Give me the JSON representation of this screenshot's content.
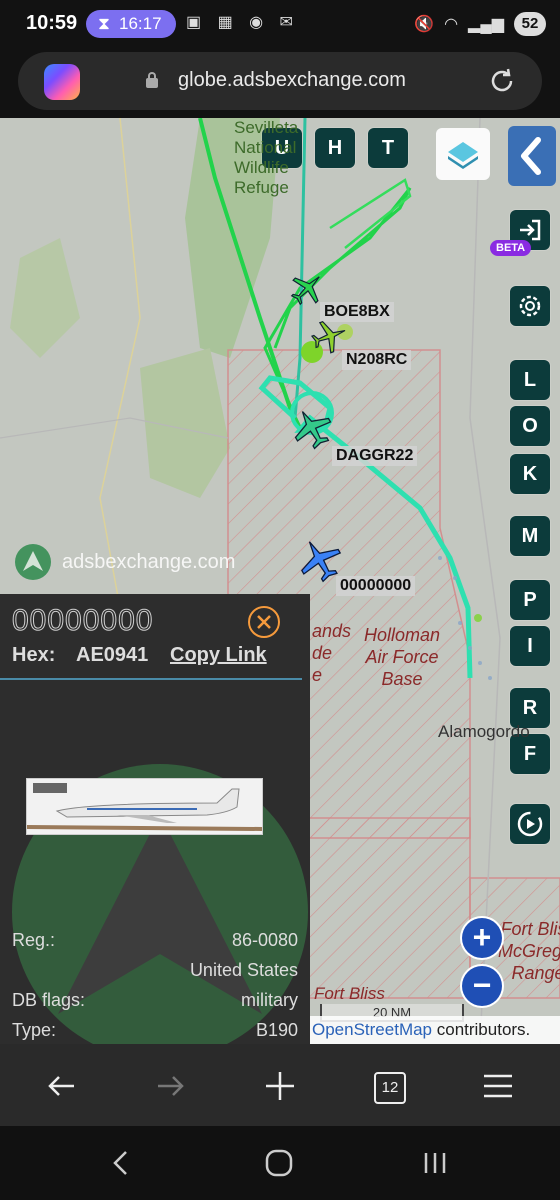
{
  "status_bar": {
    "time": "10:59",
    "timer": "16:17",
    "battery": "52"
  },
  "browser": {
    "url": "globe.adsbexchange.com"
  },
  "map": {
    "header_buttons": [
      "U",
      "H",
      "T"
    ],
    "side_buttons": [
      "L",
      "O",
      "K",
      "M",
      "P",
      "I",
      "R",
      "F"
    ],
    "beta_badge": "BETA",
    "aircraft_labels": {
      "boe8bx": "BOE8BX",
      "n208rc": "N208RC",
      "daggr22": "DAGGR22",
      "selected": "00000000"
    },
    "watermark": "adsbexchange.com",
    "place_labels": {
      "sevilleta": [
        "Sevilleta",
        "National",
        "Wildlife",
        "Refuge"
      ],
      "holloman": [
        "Holloman",
        "Air Force",
        "Base"
      ],
      "alamogordo": "Alamogordo",
      "fort_bliss_range": [
        "Fort Bliss",
        "McGregor",
        "Range"
      ],
      "fort_bliss": "Fort Bliss",
      "white_sands_fragments": [
        "ands",
        "de",
        "e"
      ]
    },
    "scale": "20 NM",
    "attribution": {
      "link": "OpenStreetMap",
      "suffix": " contributors."
    },
    "colors": {
      "track_green": "#22d34b",
      "track_teal": "#2ee0b0",
      "button_bg": "#0c3b3b",
      "restricted": "#d48a8a"
    }
  },
  "panel": {
    "callsign": "00000000",
    "hex_label": "Hex:",
    "hex_value": "AE0941",
    "copy_link": "Copy Link",
    "rows": [
      {
        "label": "Reg.:",
        "value": "86-0080"
      },
      {
        "label": "",
        "value": "United States"
      },
      {
        "label": "DB flags:",
        "value": "military"
      },
      {
        "label": "Type:",
        "value": "B190"
      }
    ]
  },
  "browser_nav": {
    "tab_count": "12"
  }
}
